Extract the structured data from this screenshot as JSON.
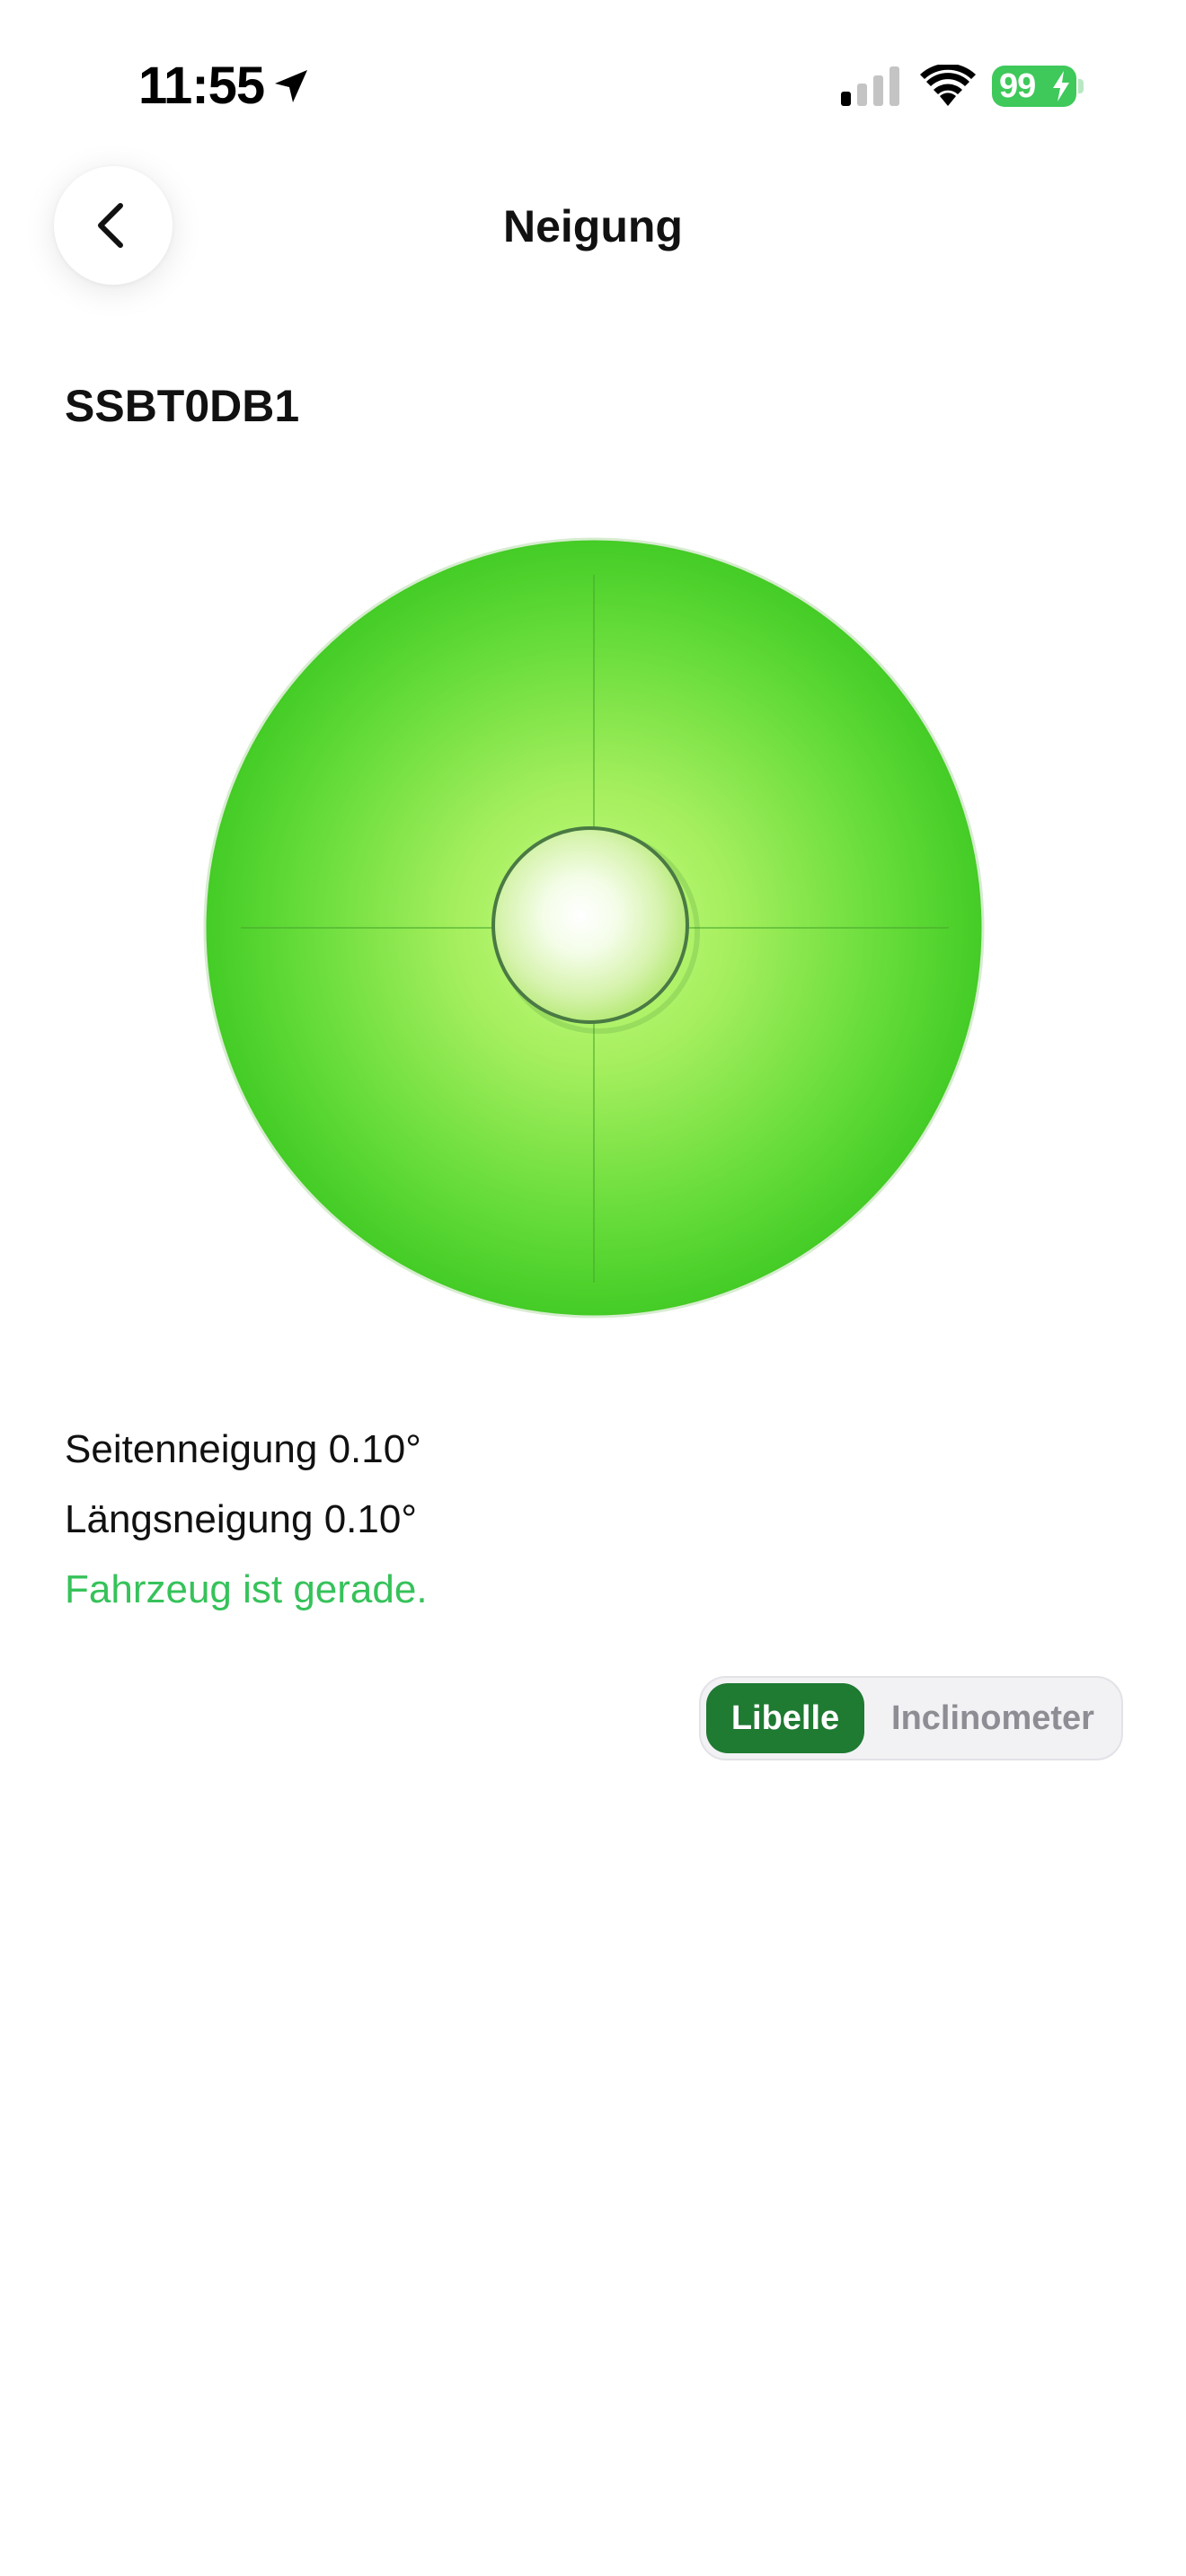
{
  "status_bar": {
    "time": "11:55",
    "battery": "99",
    "icons": [
      "location-arrow-icon",
      "cellular-signal-icon",
      "wifi-icon",
      "battery-charging-icon"
    ]
  },
  "nav": {
    "title": "Neigung",
    "back_icon": "chevron-left-icon"
  },
  "device": {
    "name": "SSBT0DB1"
  },
  "level": {
    "state_color": "#4cd230",
    "bubble_offset_deg": {
      "side": 0.1,
      "longitudinal": 0.1
    }
  },
  "readings": {
    "side_tilt": "Seitenneigung 0.10°",
    "longitudinal_tilt": "Längsneigung 0.10°",
    "status": "Fahrzeug ist gerade."
  },
  "mode_switch": {
    "options": [
      "Libelle",
      "Inclinometer"
    ],
    "selected": "Libelle"
  },
  "colors": {
    "status_ok": "#36c25a",
    "active_segment": "#1f7a32",
    "battery": "#3ec95a"
  }
}
